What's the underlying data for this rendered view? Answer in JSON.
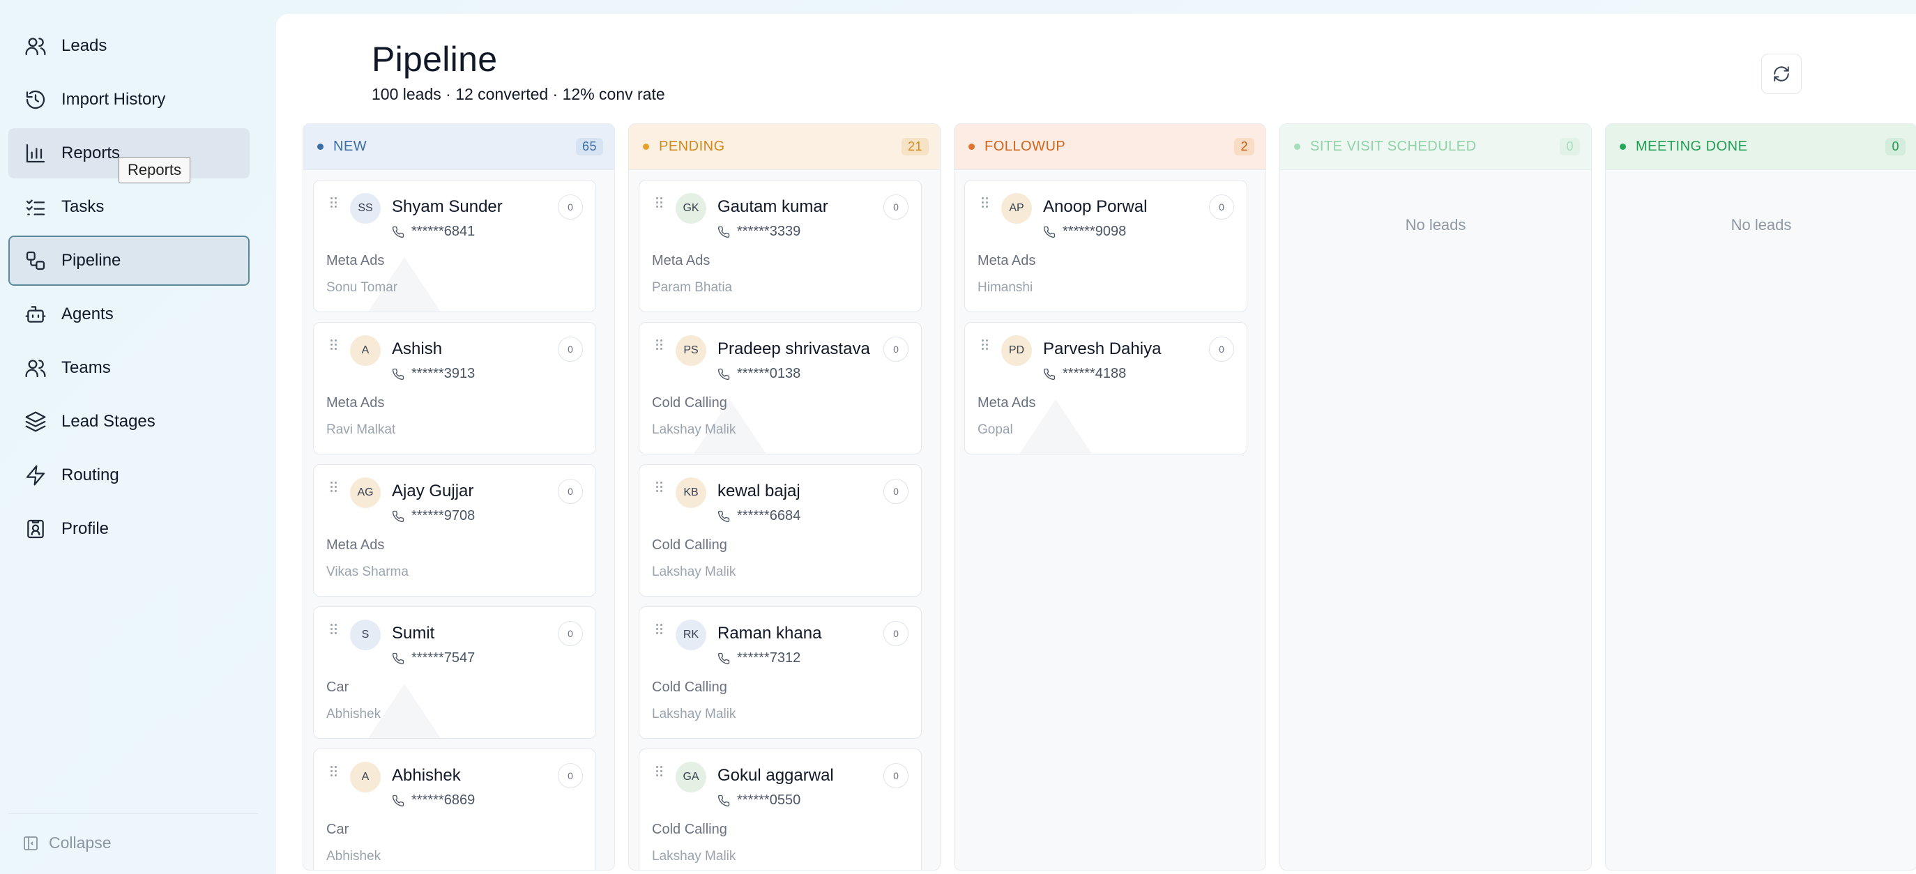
{
  "sidebar": {
    "items": [
      {
        "label": "Leads",
        "icon": "users-icon"
      },
      {
        "label": "Import History",
        "icon": "history-icon"
      },
      {
        "label": "Reports",
        "icon": "bar-chart-icon"
      },
      {
        "label": "Tasks",
        "icon": "checklist-icon"
      },
      {
        "label": "Pipeline",
        "icon": "workflow-icon"
      },
      {
        "label": "Agents",
        "icon": "bot-icon"
      },
      {
        "label": "Teams",
        "icon": "team-icon"
      },
      {
        "label": "Lead Stages",
        "icon": "layers-icon"
      },
      {
        "label": "Routing",
        "icon": "lightning-icon"
      },
      {
        "label": "Profile",
        "icon": "contact-badge-icon"
      }
    ],
    "tooltip": "Reports",
    "collapse_label": "Collapse"
  },
  "page": {
    "title": "Pipeline",
    "stats": "100 leads · 12 converted · 12% conv rate"
  },
  "columns": [
    {
      "name": "NEW",
      "count": "65",
      "cards": [
        {
          "initials": "SS",
          "name": "Shyam Sunder",
          "phone": "******6841",
          "source": "Meta Ads",
          "agent": "Sonu Tomar",
          "badge": "0"
        },
        {
          "initials": "A",
          "name": "Ashish",
          "phone": "******3913",
          "source": "Meta Ads",
          "agent": "Ravi Malkat",
          "badge": "0"
        },
        {
          "initials": "AG",
          "name": "Ajay Gujjar",
          "phone": "******9708",
          "source": "Meta Ads",
          "agent": "Vikas Sharma",
          "badge": "0"
        },
        {
          "initials": "S",
          "name": "Sumit",
          "phone": "******7547",
          "source": "Car",
          "agent": "Abhishek",
          "badge": "0"
        },
        {
          "initials": "A",
          "name": "Abhishek",
          "phone": "******6869",
          "source": "Car",
          "agent": "Abhishek",
          "badge": "0"
        }
      ]
    },
    {
      "name": "PENDING",
      "count": "21",
      "cards": [
        {
          "initials": "GK",
          "name": "Gautam kumar",
          "phone": "******3339",
          "source": "Meta Ads",
          "agent": "Param Bhatia",
          "badge": "0"
        },
        {
          "initials": "PS",
          "name": "Pradeep shrivastava",
          "phone": "******0138",
          "source": "Cold Calling",
          "agent": "Lakshay Malik",
          "badge": "0"
        },
        {
          "initials": "KB",
          "name": "kewal bajaj",
          "phone": "******6684",
          "source": "Cold Calling",
          "agent": "Lakshay Malik",
          "badge": "0"
        },
        {
          "initials": "RK",
          "name": "Raman khana",
          "phone": "******7312",
          "source": "Cold Calling",
          "agent": "Lakshay Malik",
          "badge": "0"
        },
        {
          "initials": "GA",
          "name": "Gokul aggarwal",
          "phone": "******0550",
          "source": "Cold Calling",
          "agent": "Lakshay Malik",
          "badge": "0"
        }
      ]
    },
    {
      "name": "FOLLOWUP",
      "count": "2",
      "cards": [
        {
          "initials": "AP",
          "name": "Anoop Porwal",
          "phone": "******9098",
          "source": "Meta Ads",
          "agent": "Himanshi",
          "badge": "0"
        },
        {
          "initials": "PD",
          "name": "Parvesh Dahiya",
          "phone": "******4188",
          "source": "Meta Ads",
          "agent": "Gopal",
          "badge": "0"
        }
      ]
    },
    {
      "name": "SITE VISIT SCHEDULED",
      "count": "0",
      "empty_text": "No leads",
      "cards": []
    },
    {
      "name": "MEETING DONE",
      "count": "0",
      "empty_text": "No leads",
      "cards": []
    }
  ],
  "colors": {
    "avatar_blue": "#e6ecf5",
    "avatar_peach": "#f7ead7",
    "avatar_green": "#e3f0e3"
  }
}
